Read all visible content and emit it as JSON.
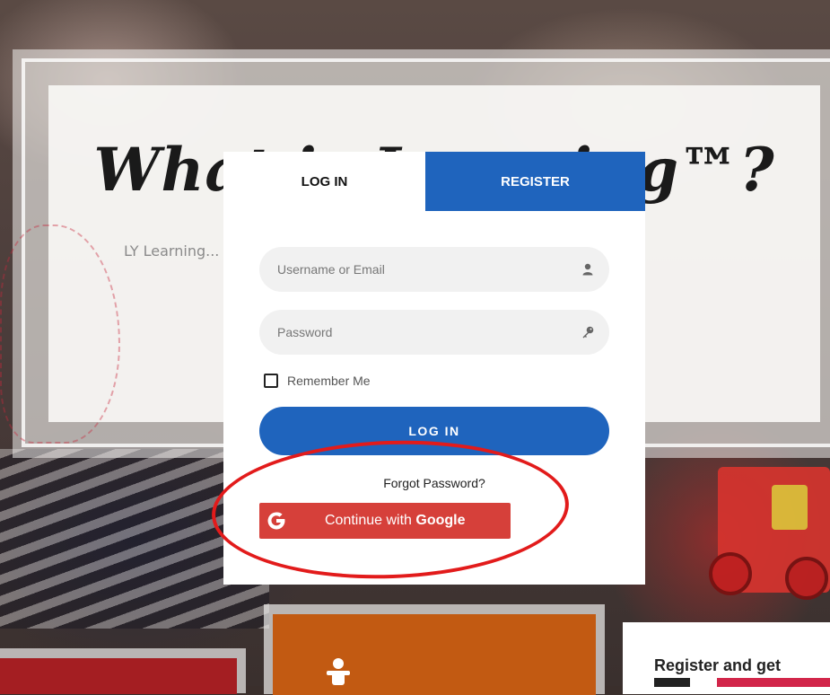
{
  "background": {
    "hero_title": "What is Learning™?",
    "hero_text": "LY Learning...                                                            them to have",
    "bottom_right_heading": "Register and get"
  },
  "modal": {
    "tabs": [
      {
        "label": "LOG IN",
        "active": true
      },
      {
        "label": "REGISTER",
        "active": false
      }
    ],
    "username": {
      "placeholder": "Username or Email",
      "value": "",
      "icon": "user-icon"
    },
    "password": {
      "placeholder": "Password",
      "value": "",
      "icon": "key-icon"
    },
    "remember_label": "Remember Me",
    "remember_checked": false,
    "login_button": "LOG IN",
    "forgot_label": "Forgot Password?",
    "google": {
      "prefix": "Continue with ",
      "brand": "Google",
      "icon": "google-g-icon"
    }
  },
  "colors": {
    "primary_blue": "#1f64bd",
    "google_red": "#d6403a",
    "annotation_red": "#e21b1b"
  }
}
